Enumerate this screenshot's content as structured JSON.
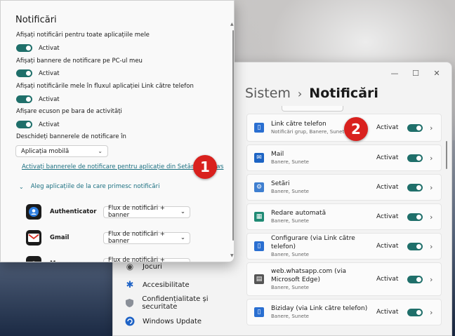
{
  "settings": {
    "breadcrumb_parent": "Sistem",
    "breadcrumb_sep": "›",
    "breadcrumb_current": "Notificări",
    "window_controls": [
      "—",
      "☐",
      "✕"
    ],
    "nav": [
      {
        "label": "Jocuri",
        "icon": "gamepad-icon"
      },
      {
        "label": "Accesibilitate",
        "icon": "accessibility-icon"
      },
      {
        "label": "Confidențialitate și securitate",
        "icon": "shield-icon"
      },
      {
        "label": "Windows Update",
        "icon": "update-icon"
      }
    ],
    "apps": [
      {
        "name": "Link către telefon",
        "sub": "Notificări grup, Banere, Sunete",
        "state": "Activat",
        "icon": "phone-link-icon",
        "color": "#2a6fd1"
      },
      {
        "name": "Mail",
        "sub": "Banere, Sunete",
        "state": "Activat",
        "icon": "mail-icon",
        "color": "#1d64c4"
      },
      {
        "name": "Setări",
        "sub": "Banere, Sunete",
        "state": "Activat",
        "icon": "settings-icon",
        "color": "#3f7fd0"
      },
      {
        "name": "Redare automată",
        "sub": "Banere, Sunete",
        "state": "Activat",
        "icon": "autoplay-icon",
        "color": "#1f8a74"
      },
      {
        "name": "Configurare (via Link către telefon)",
        "sub": "Banere, Sunete",
        "state": "Activat",
        "icon": "phone-link-icon",
        "color": "#2a6fd1"
      },
      {
        "name": "web.whatsapp.com (via Microsoft Edge)",
        "sub": "Banere, Sunete",
        "state": "Activat",
        "icon": "document-icon",
        "color": "#555555"
      },
      {
        "name": "Biziday (via Link către telefon)",
        "sub": "Banere, Sunete",
        "state": "Activat",
        "icon": "phone-link-icon",
        "color": "#2a6fd1"
      }
    ]
  },
  "panel": {
    "title": "Notificări",
    "options": [
      {
        "label": "Afișați notificări pentru toate aplicațiile mele",
        "state": "Activat"
      },
      {
        "label": "Afișați bannere de notificare pe PC-ul meu",
        "state": "Activat"
      },
      {
        "label": "Afișați notificările mele în fluxul aplicației Link către telefon",
        "state": "Activat"
      },
      {
        "label": "Afișare ecuson pe bara de activități",
        "state": "Activat"
      }
    ],
    "banner_label": "Deschideți bannerele de notificare în",
    "banner_value": "Aplicația mobilă",
    "link": "Activați bannerele de notificare pentru aplicație din Setări Windows",
    "section": "Aleg aplicațiile de la care primesc notificări",
    "apps": [
      {
        "name": "Authenticator",
        "mode": "Flux de notificări + banner",
        "icon": "authenticator-icon"
      },
      {
        "name": "Gmail",
        "mode": "Flux de notificări + banner",
        "icon": "gmail-icon"
      },
      {
        "name": "M",
        "mode": "Flux de notificări + banner",
        "icon": "app-icon"
      }
    ]
  },
  "markers": [
    "1",
    "2"
  ],
  "colors": {
    "accent": "#1f6f6a",
    "link": "#1a6f80",
    "marker": "#d9211e"
  }
}
